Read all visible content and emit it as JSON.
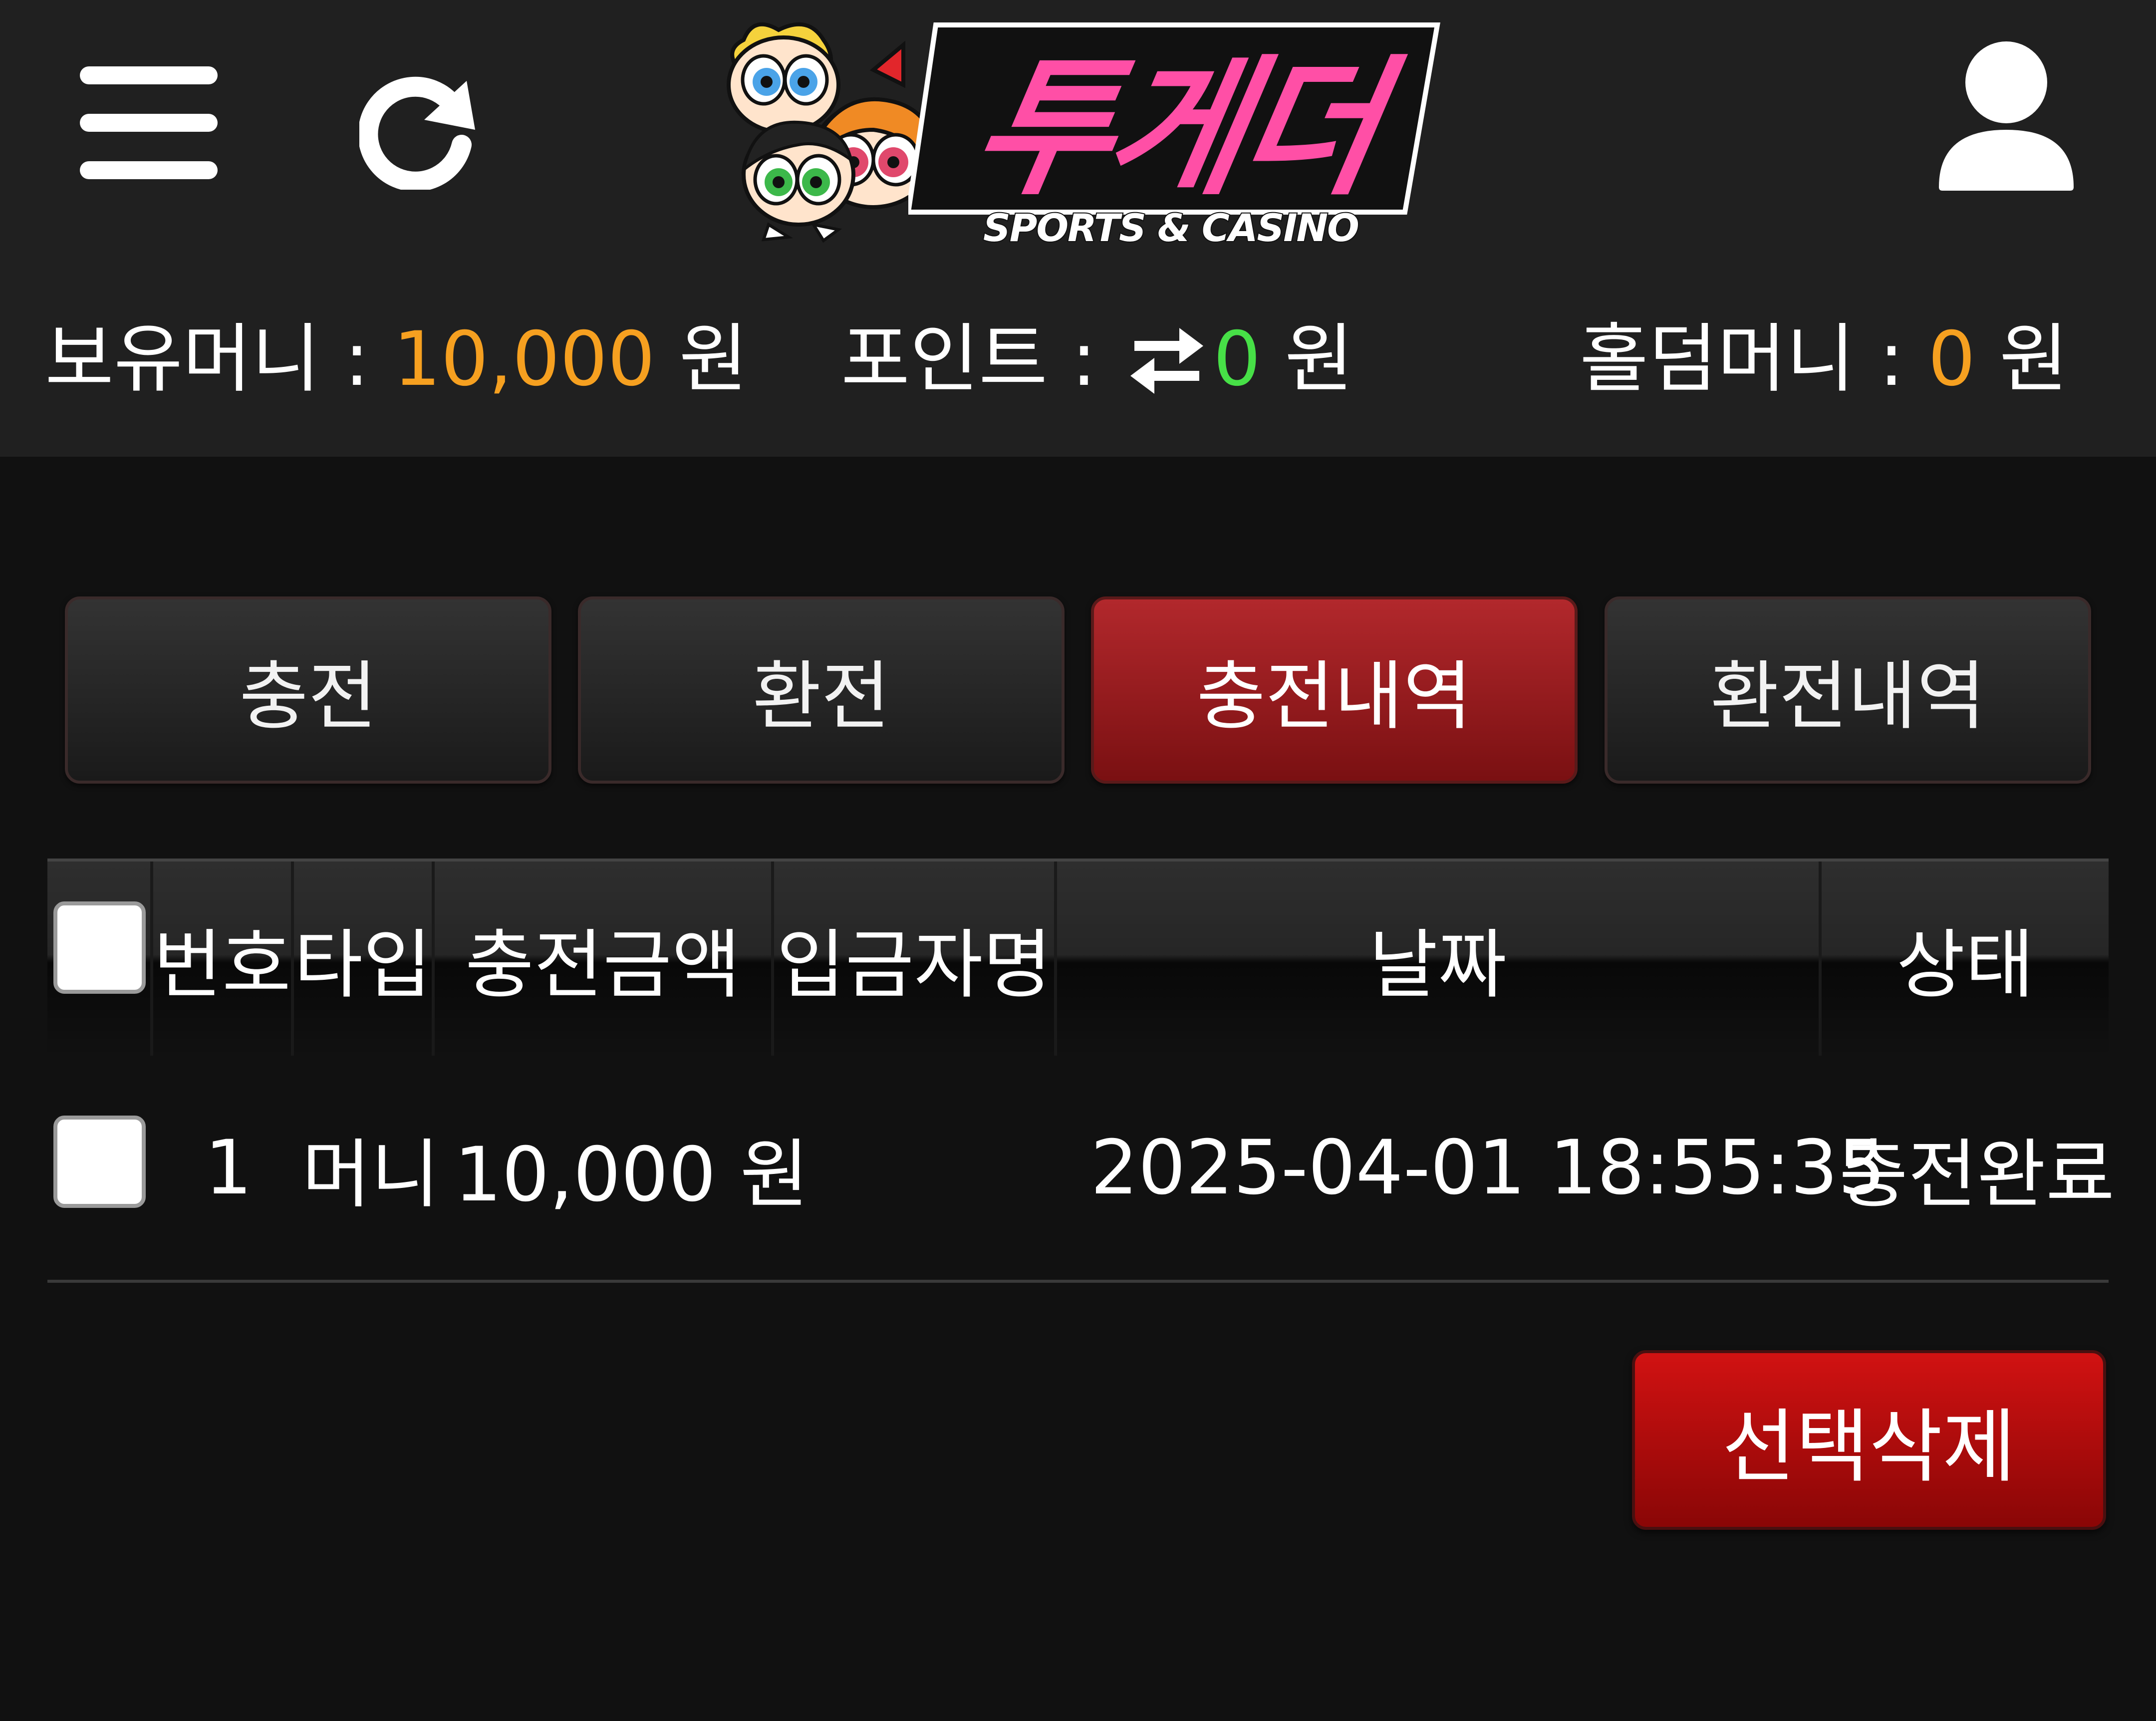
{
  "header": {
    "logo_text": "투게더",
    "logo_subtitle": "SPORTS & CASINO",
    "colors": {
      "logo_pink": "#ff4fa6",
      "header_bg": "#202020"
    }
  },
  "wallet": {
    "money_label": "보유머니 : ",
    "money_amount": "10,000",
    "money_unit": " 원",
    "point_label": "포인트 : ",
    "point_amount": "0",
    "point_unit": " 원",
    "holdem_label": "홀덤머니 : ",
    "holdem_amount": "0",
    "holdem_unit": " 원",
    "colors": {
      "orange": "#f6a020",
      "green": "#47e047"
    }
  },
  "tabs": [
    {
      "label": "충전",
      "active": false
    },
    {
      "label": "환전",
      "active": false
    },
    {
      "label": "충전내역",
      "active": true
    },
    {
      "label": "환전내역",
      "active": false
    }
  ],
  "table": {
    "columns": [
      "번호",
      "타입",
      "충전금액",
      "입금자명",
      "날짜",
      "상태"
    ],
    "rows": [
      {
        "no": "1",
        "type": "머니",
        "amount": "10,000 원",
        "depositor": "",
        "date": "2025-04-01 18:55:35",
        "status": "충전완료"
      }
    ]
  },
  "actions": {
    "delete_selected": "선택삭제",
    "delete_color": "#d11212"
  }
}
